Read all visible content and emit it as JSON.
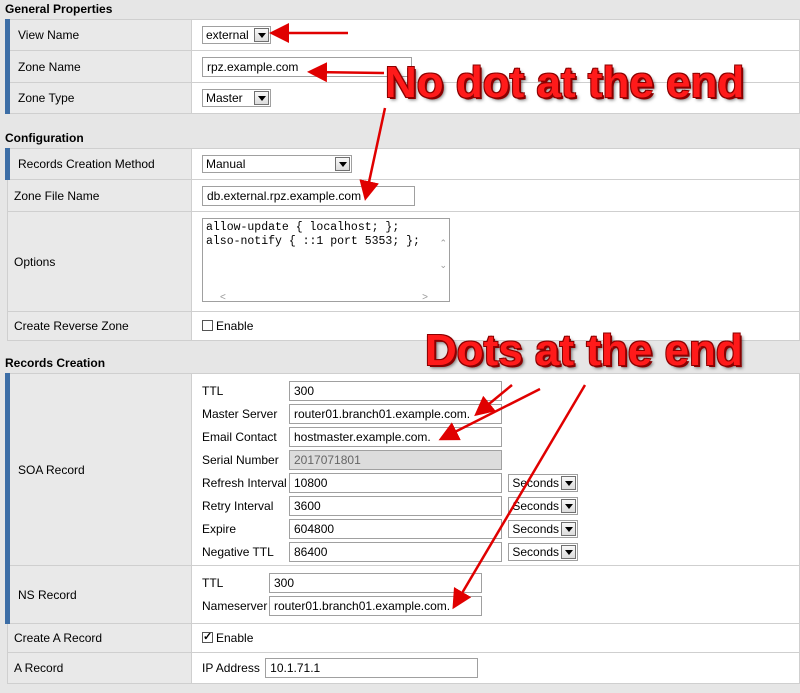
{
  "sections": {
    "general": "General Properties",
    "configuration": "Configuration",
    "records": "Records Creation"
  },
  "general": {
    "view_name_label": "View Name",
    "view_name_value": "external",
    "zone_name_label": "Zone Name",
    "zone_name_value": "rpz.example.com",
    "zone_type_label": "Zone Type",
    "zone_type_value": "Master"
  },
  "config": {
    "method_label": "Records Creation Method",
    "method_value": "Manual",
    "zonefile_label": "Zone File Name",
    "zonefile_value": "db.external.rpz.example.com",
    "options_label": "Options",
    "options_value": "allow-update { localhost; };\nalso-notify { ::1 port 5353; };",
    "reverse_label": "Create Reverse Zone",
    "reverse_enable": "Enable"
  },
  "soa": {
    "label": "SOA Record",
    "ttl_label": "TTL",
    "ttl_value": "300",
    "master_label": "Master Server",
    "master_value": "router01.branch01.example.com.",
    "email_label": "Email Contact",
    "email_value": "hostmaster.example.com.",
    "serial_label": "Serial Number",
    "serial_value": "2017071801",
    "refresh_label": "Refresh Interval",
    "refresh_value": "10800",
    "refresh_unit": "Seconds",
    "retry_label": "Retry Interval",
    "retry_value": "3600",
    "retry_unit": "Seconds",
    "expire_label": "Expire",
    "expire_value": "604800",
    "expire_unit": "Seconds",
    "negttl_label": "Negative TTL",
    "negttl_value": "86400",
    "negttl_unit": "Seconds"
  },
  "ns": {
    "label": "NS Record",
    "ttl_label": "TTL",
    "ttl_value": "300",
    "nameserver_label": "Nameserver",
    "nameserver_value": "router01.branch01.example.com."
  },
  "arec": {
    "create_label": "Create A Record",
    "create_enable": "Enable",
    "label": "A Record",
    "ip_label": "IP Address",
    "ip_value": "10.1.71.1"
  },
  "annotations": {
    "no_dot": "No dot at the end",
    "dots": "Dots at the end"
  },
  "colors": {
    "accent": "#3d6ea6",
    "annotation": "#ff1a1a"
  }
}
